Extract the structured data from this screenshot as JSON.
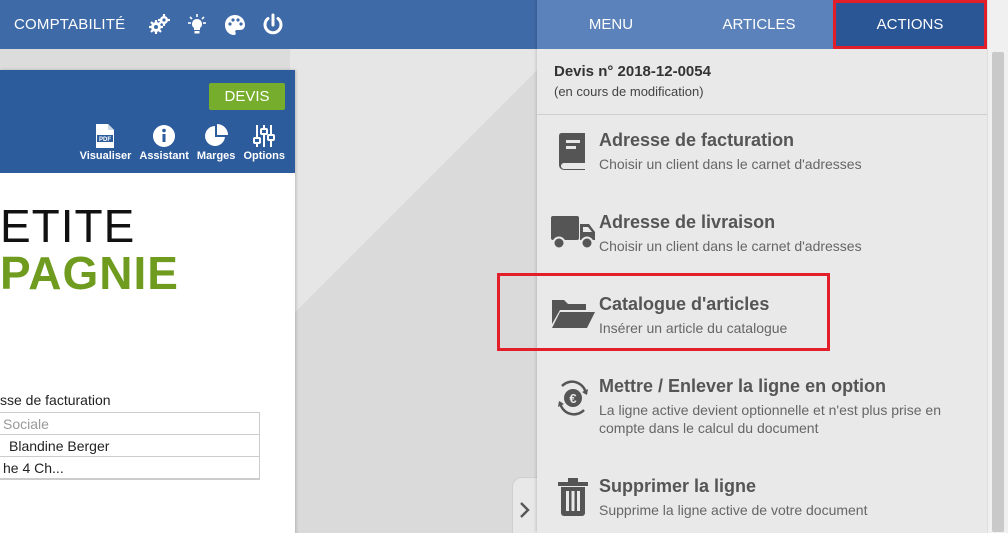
{
  "topbar": {
    "brand": "COMPTABILITÉ",
    "icons": [
      "gears-icon",
      "lightbulb-icon",
      "palette-icon",
      "power-icon"
    ]
  },
  "document": {
    "devis_label": "DEVIS",
    "tools": [
      {
        "label": "Visualiser",
        "icon": "pdf-icon"
      },
      {
        "label": "Assistant",
        "icon": "info-icon"
      },
      {
        "label": "Marges",
        "icon": "pie-chart-icon"
      },
      {
        "label": "Options",
        "icon": "sliders-icon"
      }
    ],
    "logo_line1": "ETITE",
    "logo_line2": "PAGNIE",
    "address_title": "sse de facturation",
    "address_rows": [
      "Sociale",
      "Blandine Berger",
      "he 4 Ch..."
    ]
  },
  "panel": {
    "tabs": [
      "MENU",
      "ARTICLES",
      "ACTIONS"
    ],
    "active_tab": "ACTIONS",
    "devis_title": "Devis n° 2018-12-0054",
    "devis_status": "(en cours de modification)",
    "actions": [
      {
        "title": "Adresse de facturation",
        "subtitle": "Choisir un client dans le carnet d'adresses",
        "icon": "address-book-icon"
      },
      {
        "title": "Adresse de livraison",
        "subtitle": "Choisir un client dans le carnet d'adresses",
        "icon": "truck-icon"
      },
      {
        "title": "Catalogue d'articles",
        "subtitle": "Insérer un article du catalogue",
        "icon": "folder-open-icon"
      },
      {
        "title": "Mettre / Enlever la ligne en option",
        "subtitle": "La ligne active devient optionnelle et n'est plus prise en compte dans le calcul du document",
        "icon": "euro-cycle-icon"
      },
      {
        "title": "Supprimer la ligne",
        "subtitle": "Supprime la ligne active de votre document",
        "icon": "trash-icon"
      }
    ]
  },
  "colors": {
    "topbar": "#3f6aa8",
    "doc_header": "#2d5c9c",
    "devis_green": "#77ad2d",
    "highlight_red": "#e31e2b",
    "active_tab": "#2a5696"
  }
}
